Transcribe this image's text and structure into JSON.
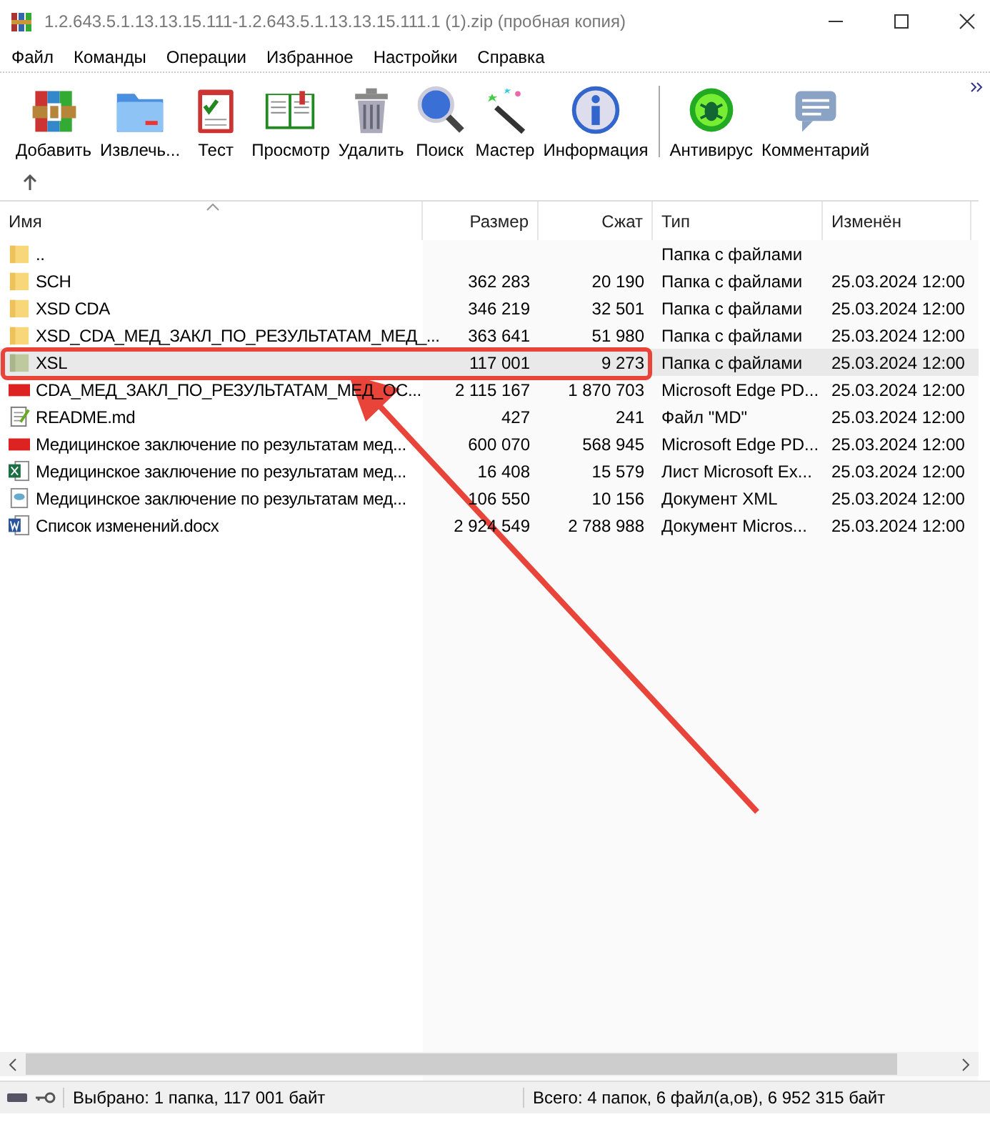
{
  "window": {
    "title": "1.2.643.5.1.13.13.15.111-1.2.643.5.1.13.13.15.111.1 (1).zip (пробная копия)"
  },
  "menu": [
    "Файл",
    "Команды",
    "Операции",
    "Избранное",
    "Настройки",
    "Справка"
  ],
  "toolbar": [
    {
      "label": "Добавить",
      "kind": "add"
    },
    {
      "label": "Извлечь...",
      "kind": "extract"
    },
    {
      "label": "Тест",
      "kind": "test"
    },
    {
      "label": "Просмотр",
      "kind": "view"
    },
    {
      "label": "Удалить",
      "kind": "delete"
    },
    {
      "label": "Поиск",
      "kind": "find"
    },
    {
      "label": "Мастер",
      "kind": "wizard"
    },
    {
      "label": "Информация",
      "kind": "info"
    },
    {
      "label": "Антивирус",
      "kind": "virus"
    },
    {
      "label": "Комментарий",
      "kind": "comment"
    }
  ],
  "table": {
    "columns": [
      "Имя",
      "Размер",
      "Сжат",
      "Тип",
      "Изменён"
    ],
    "rows": [
      {
        "kind": "folder",
        "selected": false,
        "name": "..",
        "size": "",
        "packed": "",
        "type": "Папка с файлами",
        "modified": ""
      },
      {
        "kind": "folder",
        "selected": false,
        "name": "SCH",
        "size": "362 283",
        "packed": "20 190",
        "type": "Папка с файлами",
        "modified": "25.03.2024 12:00"
      },
      {
        "kind": "folder",
        "selected": false,
        "name": "XSD CDA",
        "size": "346 219",
        "packed": "32 501",
        "type": "Папка с файлами",
        "modified": "25.03.2024 12:00"
      },
      {
        "kind": "folder",
        "selected": false,
        "name": "XSD_CDA_МЕД_ЗАКЛ_ПО_РЕЗУЛЬТАТАМ_МЕД_...",
        "size": "363 641",
        "packed": "51 980",
        "type": "Папка с файлами",
        "modified": "25.03.2024 12:00"
      },
      {
        "kind": "folder",
        "selected": true,
        "name": "XSL",
        "size": "117 001",
        "packed": "9 273",
        "type": "Папка с файлами",
        "modified": "25.03.2024 12:00"
      },
      {
        "kind": "pdf",
        "selected": false,
        "name": "CDA_МЕД_ЗАКЛ_ПО_РЕЗУЛЬТАТАМ_МЕД_ОС...",
        "size": "2 115 167",
        "packed": "1 870 703",
        "type": "Microsoft Edge PD...",
        "modified": "25.03.2024 12:00"
      },
      {
        "kind": "text",
        "selected": false,
        "name": "README.md",
        "size": "427",
        "packed": "241",
        "type": "Файл \"MD\"",
        "modified": "25.03.2024 12:00"
      },
      {
        "kind": "pdf",
        "selected": false,
        "name": "Медицинское заключение по результатам мед...",
        "size": "600 070",
        "packed": "568 945",
        "type": "Microsoft Edge PD...",
        "modified": "25.03.2024 12:00"
      },
      {
        "kind": "excel",
        "selected": false,
        "name": "Медицинское заключение по результатам мед...",
        "size": "16 408",
        "packed": "15 579",
        "type": "Лист Microsoft Ex...",
        "modified": "25.03.2024 12:00"
      },
      {
        "kind": "xml",
        "selected": false,
        "name": "Медицинское заключение по результатам мед...",
        "size": "106 550",
        "packed": "10 156",
        "type": "Документ XML",
        "modified": "25.03.2024 12:00"
      },
      {
        "kind": "word",
        "selected": false,
        "name": "Список изменений.docx",
        "size": "2 924 549",
        "packed": "2 788 988",
        "type": "Документ Micros...",
        "modified": "25.03.2024 12:00"
      }
    ]
  },
  "status_bar": {
    "selected": "Выбрано: 1 папка, 117 001 байт",
    "total": "Всего: 4 папок, 6 файл(а,ов), 6 952 315 байт"
  }
}
